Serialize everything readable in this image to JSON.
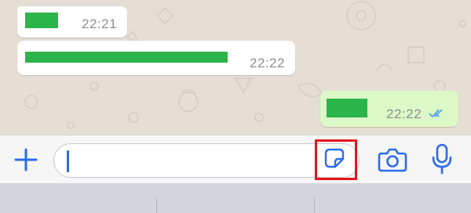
{
  "messages": [
    {
      "direction": "incoming",
      "time": "22:21"
    },
    {
      "direction": "incoming",
      "time": "22:22"
    },
    {
      "direction": "outgoing",
      "time": "22:22",
      "status": "read"
    }
  ],
  "composer": {
    "placeholder": "",
    "value": "",
    "icons": {
      "add": "plus-icon",
      "sticker": "sticker-icon",
      "camera": "camera-icon",
      "mic": "microphone-icon"
    },
    "highlighted_control": "sticker-button"
  },
  "colors": {
    "accent": "#2b6cf0",
    "incoming_bubble": "#ffffff",
    "outgoing_bubble": "#dcf8c6",
    "redaction": "#2bb44a",
    "highlight": "#e4141b",
    "read_ticks": "#4fa3f0"
  }
}
